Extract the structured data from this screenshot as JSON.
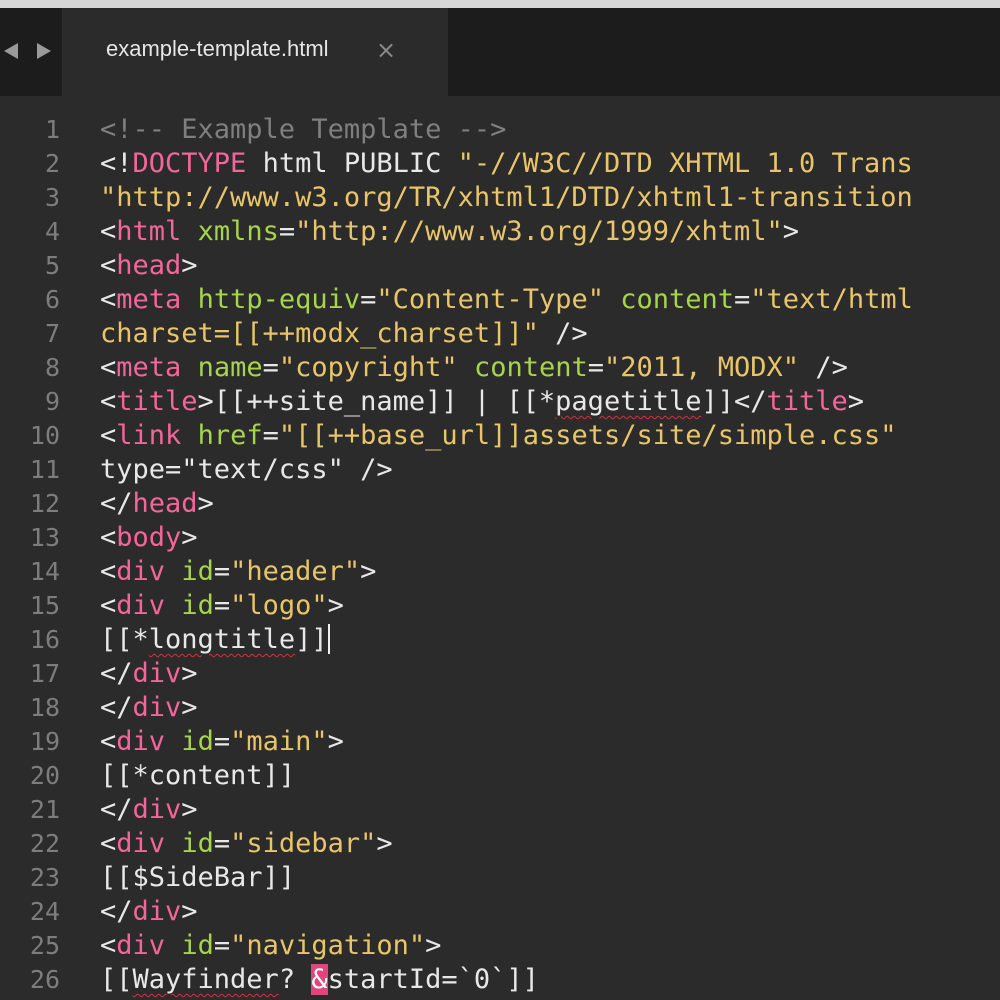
{
  "tabs": [
    {
      "title": "example-template.html",
      "close_glyph": "×",
      "active": true
    }
  ],
  "icons": {
    "back": "triangle-left-icon",
    "forward": "triangle-right-icon",
    "close": "close-icon"
  },
  "colors": {
    "background": "#2b2b2b",
    "tab_bar": "#1c1c1c",
    "gutter_text": "#7d7d7d",
    "plain": "#e8e8e8",
    "comment": "#7f7f7f",
    "tag": "#f3669a",
    "attr": "#a6d44a",
    "string": "#e8c56b",
    "highlight": "#e0457b"
  },
  "editor": {
    "cursor_line": 16,
    "lines": [
      {
        "n": "1",
        "tokens": [
          {
            "t": "<!-- Example Template -->",
            "k": "comment"
          }
        ]
      },
      {
        "n": "2",
        "tokens": [
          {
            "t": "<!",
            "k": "plain"
          },
          {
            "t": "DOCTYPE",
            "k": "tag"
          },
          {
            "t": " html PUBLIC ",
            "k": "plain"
          },
          {
            "t": "\"-//W3C//DTD XHTML 1.0 Trans",
            "k": "str"
          }
        ]
      },
      {
        "n": "3",
        "tokens": [
          {
            "t": "\"http://www.w3.org/TR/xhtml1/DTD/xhtml1-transition",
            "k": "str"
          }
        ]
      },
      {
        "n": "4",
        "tokens": [
          {
            "t": "<",
            "k": "plain"
          },
          {
            "t": "html",
            "k": "tag"
          },
          {
            "t": " ",
            "k": "plain"
          },
          {
            "t": "xmlns",
            "k": "attr"
          },
          {
            "t": "=",
            "k": "plain"
          },
          {
            "t": "\"http://www.w3.org/1999/xhtml\"",
            "k": "str"
          },
          {
            "t": ">",
            "k": "plain"
          }
        ]
      },
      {
        "n": "5",
        "tokens": [
          {
            "t": "<",
            "k": "plain"
          },
          {
            "t": "head",
            "k": "tag"
          },
          {
            "t": ">",
            "k": "plain"
          }
        ]
      },
      {
        "n": "6",
        "tokens": [
          {
            "t": "<",
            "k": "plain"
          },
          {
            "t": "meta",
            "k": "tag"
          },
          {
            "t": " ",
            "k": "plain"
          },
          {
            "t": "http-equiv",
            "k": "attr"
          },
          {
            "t": "=",
            "k": "plain"
          },
          {
            "t": "\"Content-Type\"",
            "k": "str"
          },
          {
            "t": " ",
            "k": "plain"
          },
          {
            "t": "content",
            "k": "attr"
          },
          {
            "t": "=",
            "k": "plain"
          },
          {
            "t": "\"text/html",
            "k": "str"
          }
        ]
      },
      {
        "n": "7",
        "tokens": [
          {
            "t": "charset=[[++modx_charset]]\"",
            "k": "str"
          },
          {
            "t": " />",
            "k": "plain"
          }
        ]
      },
      {
        "n": "8",
        "tokens": [
          {
            "t": "<",
            "k": "plain"
          },
          {
            "t": "meta",
            "k": "tag"
          },
          {
            "t": " ",
            "k": "plain"
          },
          {
            "t": "name",
            "k": "attr"
          },
          {
            "t": "=",
            "k": "plain"
          },
          {
            "t": "\"copyright\"",
            "k": "str"
          },
          {
            "t": " ",
            "k": "plain"
          },
          {
            "t": "content",
            "k": "attr"
          },
          {
            "t": "=",
            "k": "plain"
          },
          {
            "t": "\"2011, MODX\"",
            "k": "str"
          },
          {
            "t": " />",
            "k": "plain"
          }
        ]
      },
      {
        "n": "9",
        "tokens": [
          {
            "t": "<",
            "k": "plain"
          },
          {
            "t": "title",
            "k": "tag"
          },
          {
            "t": ">[[++site_name]] | [[*",
            "k": "plain"
          },
          {
            "t": "pagetitle",
            "k": "plain",
            "spell": true
          },
          {
            "t": "]]</",
            "k": "plain"
          },
          {
            "t": "title",
            "k": "tag"
          },
          {
            "t": ">",
            "k": "plain"
          }
        ]
      },
      {
        "n": "10",
        "tokens": [
          {
            "t": "<",
            "k": "plain"
          },
          {
            "t": "link",
            "k": "tag"
          },
          {
            "t": " ",
            "k": "plain"
          },
          {
            "t": "href",
            "k": "attr"
          },
          {
            "t": "=",
            "k": "plain"
          },
          {
            "t": "\"[[++base_url]]assets/site/simple.css\"",
            "k": "str"
          }
        ]
      },
      {
        "n": "11",
        "tokens": [
          {
            "t": "type=\"text/css\" />",
            "k": "plain"
          }
        ]
      },
      {
        "n": "12",
        "tokens": [
          {
            "t": "</",
            "k": "plain"
          },
          {
            "t": "head",
            "k": "tag"
          },
          {
            "t": ">",
            "k": "plain"
          }
        ]
      },
      {
        "n": "13",
        "tokens": [
          {
            "t": "<",
            "k": "plain"
          },
          {
            "t": "body",
            "k": "tag"
          },
          {
            "t": ">",
            "k": "plain"
          }
        ]
      },
      {
        "n": "14",
        "tokens": [
          {
            "t": "<",
            "k": "plain"
          },
          {
            "t": "div",
            "k": "tag"
          },
          {
            "t": " ",
            "k": "plain"
          },
          {
            "t": "id",
            "k": "attr"
          },
          {
            "t": "=",
            "k": "plain"
          },
          {
            "t": "\"header\"",
            "k": "str"
          },
          {
            "t": ">",
            "k": "plain"
          }
        ]
      },
      {
        "n": "15",
        "tokens": [
          {
            "t": "<",
            "k": "plain"
          },
          {
            "t": "div",
            "k": "tag"
          },
          {
            "t": " ",
            "k": "plain"
          },
          {
            "t": "id",
            "k": "attr"
          },
          {
            "t": "=",
            "k": "plain"
          },
          {
            "t": "\"logo\"",
            "k": "str"
          },
          {
            "t": ">",
            "k": "plain"
          }
        ]
      },
      {
        "n": "16",
        "tokens": [
          {
            "t": "[[*",
            "k": "plain"
          },
          {
            "t": "longtitle",
            "k": "plain",
            "spell": true
          },
          {
            "t": "]]",
            "k": "plain"
          }
        ]
      },
      {
        "n": "17",
        "tokens": [
          {
            "t": "</",
            "k": "plain"
          },
          {
            "t": "div",
            "k": "tag"
          },
          {
            "t": ">",
            "k": "plain"
          }
        ]
      },
      {
        "n": "18",
        "tokens": [
          {
            "t": "</",
            "k": "plain"
          },
          {
            "t": "div",
            "k": "tag"
          },
          {
            "t": ">",
            "k": "plain"
          }
        ]
      },
      {
        "n": "19",
        "tokens": [
          {
            "t": "<",
            "k": "plain"
          },
          {
            "t": "div",
            "k": "tag"
          },
          {
            "t": " ",
            "k": "plain"
          },
          {
            "t": "id",
            "k": "attr"
          },
          {
            "t": "=",
            "k": "plain"
          },
          {
            "t": "\"main\"",
            "k": "str"
          },
          {
            "t": ">",
            "k": "plain"
          }
        ]
      },
      {
        "n": "20",
        "tokens": [
          {
            "t": "[[*content]]",
            "k": "plain"
          }
        ]
      },
      {
        "n": "21",
        "tokens": [
          {
            "t": "</",
            "k": "plain"
          },
          {
            "t": "div",
            "k": "tag"
          },
          {
            "t": ">",
            "k": "plain"
          }
        ]
      },
      {
        "n": "22",
        "tokens": [
          {
            "t": "<",
            "k": "plain"
          },
          {
            "t": "div",
            "k": "tag"
          },
          {
            "t": " ",
            "k": "plain"
          },
          {
            "t": "id",
            "k": "attr"
          },
          {
            "t": "=",
            "k": "plain"
          },
          {
            "t": "\"sidebar\"",
            "k": "str"
          },
          {
            "t": ">",
            "k": "plain"
          }
        ]
      },
      {
        "n": "23",
        "tokens": [
          {
            "t": "[[$SideBar]]",
            "k": "plain"
          }
        ]
      },
      {
        "n": "24",
        "tokens": [
          {
            "t": "</",
            "k": "plain"
          },
          {
            "t": "div",
            "k": "tag"
          },
          {
            "t": ">",
            "k": "plain"
          }
        ]
      },
      {
        "n": "25",
        "tokens": [
          {
            "t": "<",
            "k": "plain"
          },
          {
            "t": "div",
            "k": "tag"
          },
          {
            "t": " ",
            "k": "plain"
          },
          {
            "t": "id",
            "k": "attr"
          },
          {
            "t": "=",
            "k": "plain"
          },
          {
            "t": "\"navigation\"",
            "k": "str"
          },
          {
            "t": ">",
            "k": "plain"
          }
        ]
      },
      {
        "n": "26",
        "tokens": [
          {
            "t": "[[",
            "k": "plain"
          },
          {
            "t": "Wayfinder",
            "k": "plain",
            "spell": true
          },
          {
            "t": "? ",
            "k": "plain"
          },
          {
            "t": "&",
            "k": "hl"
          },
          {
            "t": "startId=`0`]]",
            "k": "plain"
          }
        ]
      }
    ]
  }
}
